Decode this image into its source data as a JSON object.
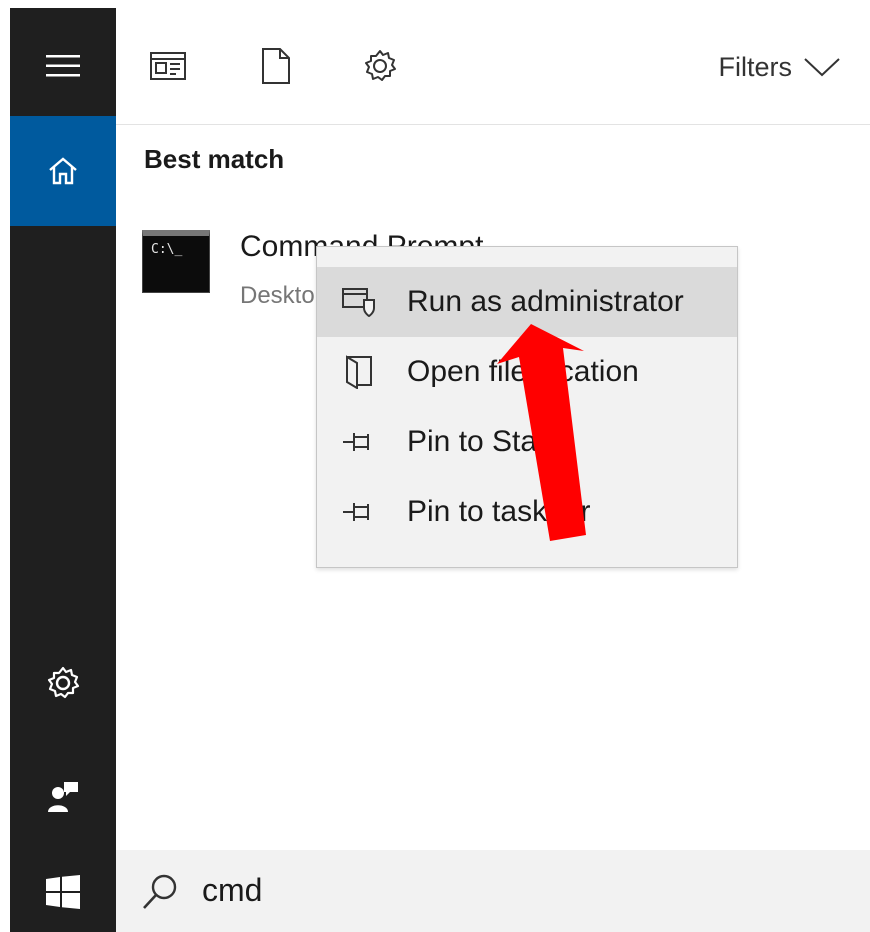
{
  "toolbar": {
    "filters_label": "Filters",
    "icons": [
      "apps-icon",
      "document-icon",
      "gear-icon"
    ]
  },
  "results": {
    "heading": "Best match",
    "item": {
      "title": "Command Prompt",
      "subtitle": "Desktop app",
      "icon_text": "C:\\_"
    }
  },
  "context_menu": {
    "items": [
      {
        "label": "Run as administrator",
        "icon": "shield-admin-icon",
        "highlighted": true
      },
      {
        "label": "Open file location",
        "icon": "folder-open-icon"
      },
      {
        "label": "Pin to Start",
        "icon": "pin-icon"
      },
      {
        "label": "Pin to taskbar",
        "icon": "pin-icon"
      }
    ]
  },
  "search": {
    "value": "cmd"
  },
  "colors": {
    "rail_bg": "#1f1f1f",
    "rail_active": "#005a9e",
    "annotation_arrow": "#ff0000",
    "menu_highlight": "#dadada"
  }
}
